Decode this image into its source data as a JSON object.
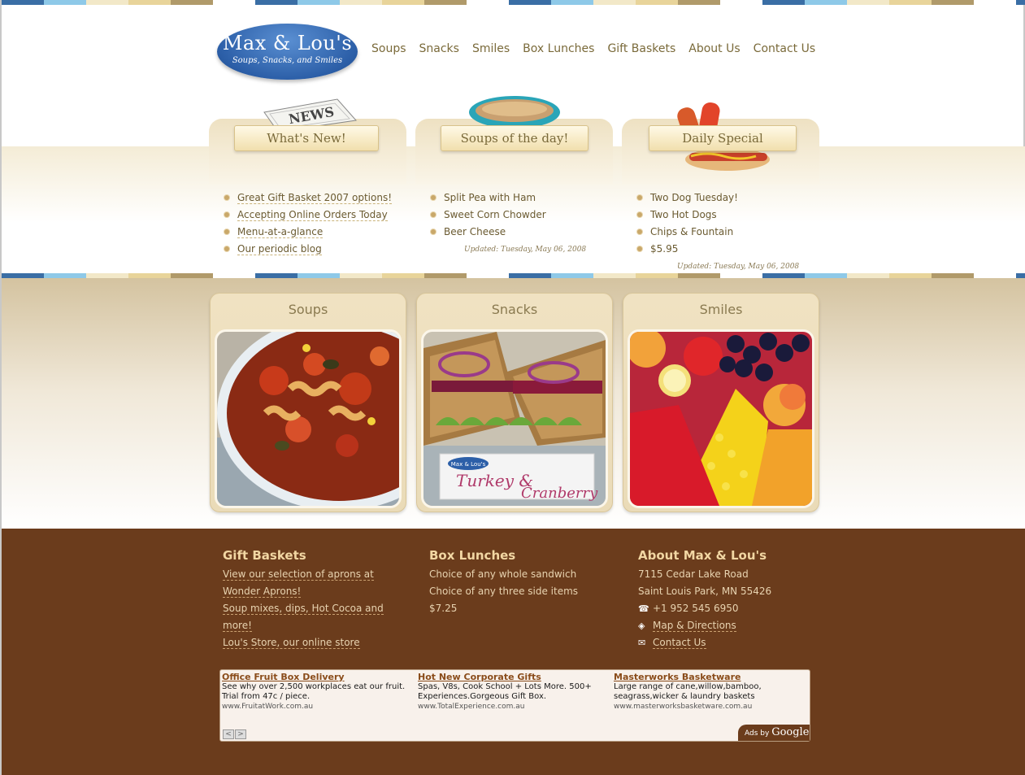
{
  "stripe_colors": [
    "#3a6ea5",
    "#8ec9e8",
    "#f2e8c8",
    "#e8d49a",
    "#b09a6a",
    "#ffffff"
  ],
  "logo": {
    "line1": "Max & Lou's",
    "line2": "Soups, Snacks, and Smiles"
  },
  "nav": [
    "Soups",
    "Snacks",
    "Smiles",
    "Box Lunches",
    "Gift Baskets",
    "About Us",
    "Contact Us"
  ],
  "panels": {
    "whats_new": {
      "title": "What's New!",
      "items": [
        "Great Gift Basket 2007 options!",
        "Accepting Online Orders Today",
        "Menu-at-a-glance",
        "Our periodic blog"
      ]
    },
    "soups": {
      "title": "Soups of the day!",
      "items": [
        "Split Pea with Ham",
        "Sweet Corn Chowder",
        "Beer Cheese"
      ],
      "updated": "Updated: Tuesday, May 06, 2008"
    },
    "special": {
      "title": "Daily Special",
      "items": [
        "Two Dog Tuesday!",
        "Two Hot Dogs",
        "Chips & Fountain",
        "$5.95"
      ],
      "updated": "Updated: Tuesday, May 06, 2008"
    }
  },
  "cards": [
    "Soups",
    "Snacks",
    "Smiles"
  ],
  "sandwich_sign": {
    "brand": "Max & Lou's",
    "text1": "Turkey &",
    "text2": "Cranberry"
  },
  "footer": {
    "gift": {
      "title": "Gift Baskets",
      "lines": [
        "View our selection of aprons at",
        "Wonder Aprons!",
        "Soup mixes, dips, Hot Cocoa and",
        "more!",
        "Lou's Store, our online store"
      ]
    },
    "box": {
      "title": "Box Lunches",
      "lines": [
        "Choice of any whole sandwich",
        "Choice of any three side items",
        "$7.25"
      ]
    },
    "about": {
      "title": "About Max & Lou's",
      "address1": "7115 Cedar Lake Road",
      "address2": "Saint Louis Park, MN 55426",
      "phone": "+1 952 545 6950",
      "map": "Map & Directions",
      "contact": "Contact Us"
    }
  },
  "ads": [
    {
      "title": "Office Fruit Box Delivery",
      "body": "See why over 2,500 workplaces eat our fruit. Trial from 47c / piece.",
      "url": "www.FruitatWork.com.au"
    },
    {
      "title": "Hot New Corporate Gifts",
      "body": "Spas, V8s, Cook School + Lots More. 500+ Experiences.Gorgeous Gift Box.",
      "url": "www.TotalExperience.com.au"
    },
    {
      "title": "Masterworks Basketware",
      "body": "Large range of cane,willow,bamboo, seagrass,wicker & laundry baskets",
      "url": "www.masterworksbasketware.com.au"
    }
  ],
  "ads_by": {
    "prefix": "Ads by",
    "brand": "Google"
  },
  "ad_nav": [
    "<",
    ">"
  ]
}
